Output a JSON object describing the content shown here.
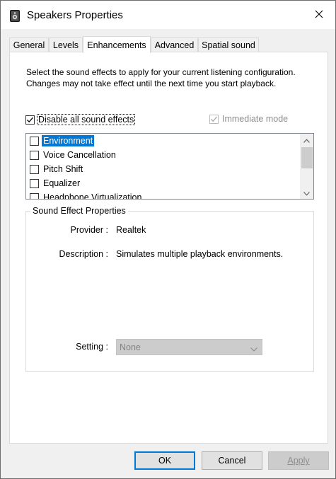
{
  "window": {
    "title": "Speakers Properties",
    "icon": "speaker-icon",
    "close_icon": "close-icon"
  },
  "tabs": [
    {
      "label": "General",
      "active": false
    },
    {
      "label": "Levels",
      "active": false
    },
    {
      "label": "Enhancements",
      "active": true
    },
    {
      "label": "Advanced",
      "active": false
    },
    {
      "label": "Spatial sound",
      "active": false
    }
  ],
  "enhancements": {
    "description": "Select the sound effects to apply for your current listening configuration. Changes may not take effect until the next time you start playback.",
    "disable_all": {
      "label": "Disable all sound effects",
      "checked": true
    },
    "immediate_mode": {
      "label": "Immediate mode",
      "checked": true,
      "enabled": false
    },
    "effects": [
      {
        "label": "Environment",
        "checked": false,
        "selected": true
      },
      {
        "label": "Voice Cancellation",
        "checked": false,
        "selected": false
      },
      {
        "label": "Pitch Shift",
        "checked": false,
        "selected": false
      },
      {
        "label": "Equalizer",
        "checked": false,
        "selected": false
      },
      {
        "label": "Headphone Virtualization",
        "checked": false,
        "selected": false
      }
    ],
    "properties": {
      "group_title": "Sound Effect Properties",
      "provider_label": "Provider :",
      "provider_value": "Realtek",
      "description_label": "Description :",
      "description_value": "Simulates multiple playback environments.",
      "setting_label": "Setting :",
      "setting_value": "None"
    }
  },
  "buttons": {
    "ok": "OK",
    "cancel": "Cancel",
    "apply": "Apply"
  },
  "colors": {
    "selection": "#0078d7",
    "window_bg": "#f0f0f0",
    "panel_bg": "#ffffff"
  }
}
